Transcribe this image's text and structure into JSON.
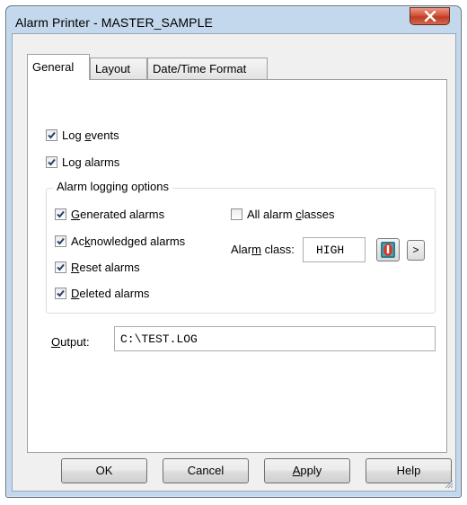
{
  "window": {
    "title": "Alarm Printer - MASTER_SAMPLE"
  },
  "tabs": [
    {
      "label": "General",
      "active": true
    },
    {
      "label": "Layout",
      "active": false
    },
    {
      "label": "Date/Time Format",
      "active": false
    }
  ],
  "general": {
    "log_events": {
      "pre": "Log ",
      "u": "e",
      "post": "vents",
      "checked": true
    },
    "log_alarms": {
      "pre": "Log alarms",
      "u": "",
      "post": "",
      "checked": true
    },
    "alarm_logging_options": {
      "title": "Alarm logging options",
      "generated": {
        "pre": "",
        "u": "G",
        "post": "enerated alarms",
        "checked": true
      },
      "acknowledged": {
        "pre": "Ac",
        "u": "k",
        "post": "nowledged alarms",
        "checked": true
      },
      "reset": {
        "pre": "",
        "u": "R",
        "post": "eset alarms",
        "checked": true
      },
      "deleted": {
        "pre": "",
        "u": "D",
        "post": "eleted alarms",
        "checked": true
      },
      "all_classes": {
        "pre": "All alarm ",
        "u": "c",
        "post": "lasses",
        "checked": false
      },
      "alarm_class": {
        "pre": "Alar",
        "u": "m",
        "post": " class:",
        "value": "HIGH"
      },
      "more_label": ">"
    },
    "output": {
      "u": "O",
      "post": "utput:",
      "value": "C:\\TEST.LOG"
    }
  },
  "buttons": {
    "ok": "OK",
    "cancel": "Cancel",
    "apply_u": "A",
    "apply_rest": "pply",
    "help": "Help"
  },
  "icons": {
    "close": "close-icon",
    "alarm_class_picker": "alarm-class-picker-icon",
    "check": "checkmark-icon",
    "resize_grip": "resize-grip-icon"
  }
}
